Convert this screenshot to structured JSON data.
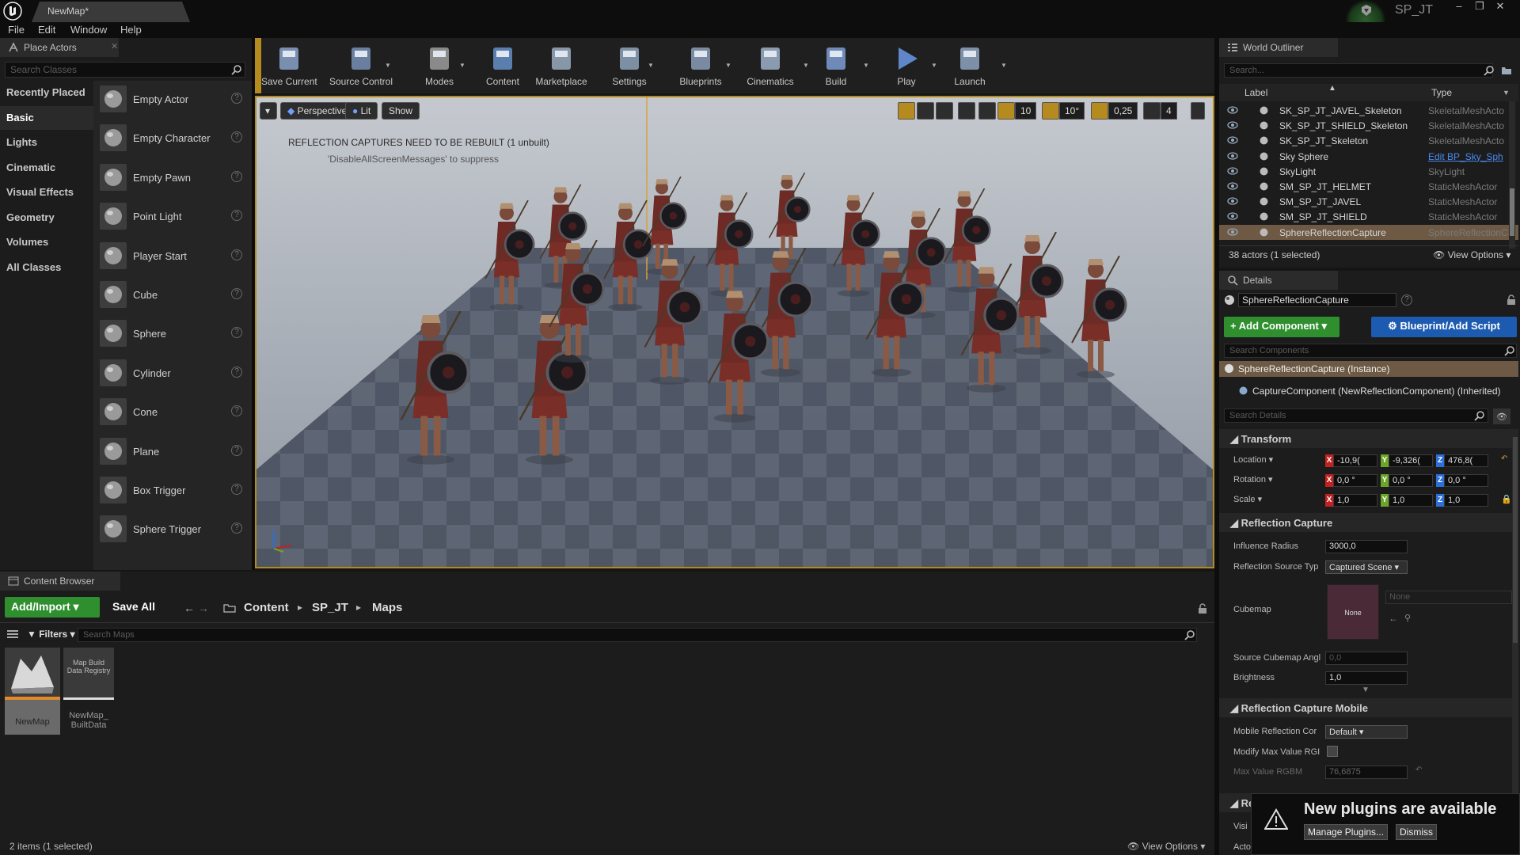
{
  "titlebar": {
    "map_tab": "NewMap*",
    "project": "SP_JT"
  },
  "menu": [
    "File",
    "Edit",
    "Window",
    "Help"
  ],
  "place_actors": {
    "tab_label": "Place Actors",
    "search_placeholder": "Search Classes",
    "categories": [
      "Recently Placed",
      "Basic",
      "Lights",
      "Cinematic",
      "Visual Effects",
      "Geometry",
      "Volumes",
      "All Classes"
    ],
    "active_category": "Basic",
    "actors": [
      "Empty Actor",
      "Empty Character",
      "Empty Pawn",
      "Point Light",
      "Player Start",
      "Cube",
      "Sphere",
      "Cylinder",
      "Cone",
      "Plane",
      "Box Trigger",
      "Sphere Trigger"
    ]
  },
  "toolbar": {
    "buttons": [
      "Save Current",
      "Source Control",
      "Modes",
      "Content",
      "Marketplace",
      "Settings",
      "Blueprints",
      "Cinematics",
      "Build",
      "Play",
      "Launch"
    ]
  },
  "viewport": {
    "perspective": "Perspective",
    "lit": "Lit",
    "show": "Show",
    "grid_snap": "10",
    "rotation_snap": "10°",
    "scale_snap": "0,25",
    "camera_speed": "4",
    "warning": "REFLECTION CAPTURES NEED TO BE REBUILT (1 unbuilt)",
    "warning_hint": "'DisableAllScreenMessages' to suppress"
  },
  "content_browser": {
    "tab_label": "Content Browser",
    "add_import": "Add/Import",
    "save_all": "Save All",
    "path": [
      "Content",
      "SP_JT",
      "Maps"
    ],
    "filters": "Filters",
    "search_placeholder": "Search Maps",
    "assets": [
      {
        "name": "NewMap",
        "thumb_text": ""
      },
      {
        "name": "NewMap_ BuiltData",
        "thumb_text": "Map Build Data Registry"
      }
    ],
    "status": "2 items (1 selected)",
    "view_options": "View Options"
  },
  "outliner": {
    "tab_label": "World Outliner",
    "search_placeholder": "Search...",
    "col_label": "Label",
    "col_type": "Type",
    "rows": [
      {
        "label": "SK_SP_JT_JAVEL_Skeleton",
        "type": "SkeletalMeshActo",
        "icon": "skeleton-icon"
      },
      {
        "label": "SK_SP_JT_SHIELD_Skeleton",
        "type": "SkeletalMeshActo",
        "icon": "skeleton-icon"
      },
      {
        "label": "SK_SP_JT_Skeleton",
        "type": "SkeletalMeshActo",
        "icon": "skeleton-icon"
      },
      {
        "label": "Sky Sphere",
        "type": "Edit BP_Sky_Sph",
        "icon": "sphere-icon"
      },
      {
        "label": "SkyLight",
        "type": "SkyLight",
        "icon": "skylight-icon"
      },
      {
        "label": "SM_SP_JT_HELMET",
        "type": "StaticMeshActor",
        "icon": "mesh-icon"
      },
      {
        "label": "SM_SP_JT_JAVEL",
        "type": "StaticMeshActor",
        "icon": "mesh-icon"
      },
      {
        "label": "SM_SP_JT_SHIELD",
        "type": "StaticMeshActor",
        "icon": "mesh-icon"
      },
      {
        "label": "SphereReflectionCapture",
        "type": "SphereReflectionC",
        "icon": "reflection-icon"
      }
    ],
    "selected_index": 8,
    "status": "38 actors (1 selected)",
    "view_options": "View Options"
  },
  "details": {
    "tab_label": "Details",
    "object_name": "SphereReflectionCapture",
    "add_component": "Add Component",
    "blueprint_script": "Blueprint/Add Script",
    "search_components": "Search Components",
    "instance": "SphereReflectionCapture (Instance)",
    "component": "CaptureComponent (NewReflectionComponent) (Inherited)",
    "search_details": "Search Details",
    "transform": {
      "header": "Transform",
      "location_label": "Location",
      "rotation_label": "Rotation",
      "scale_label": "Scale",
      "location": [
        "-10,9(",
        "-9,326(",
        "476,8("
      ],
      "rotation": [
        "0,0 °",
        "0,0 °",
        "0,0 °"
      ],
      "scale": [
        "1,0",
        "1,0",
        "1,0"
      ]
    },
    "reflection_capture": {
      "header": "Reflection Capture",
      "influence_radius_label": "Influence Radius",
      "influence_radius": "3000,0",
      "source_type_label": "Reflection Source Typ",
      "source_type": "Captured Scene",
      "cubemap_label": "Cubemap",
      "cubemap_value": "None",
      "cubemap_dropdown": "None",
      "angle_label": "Source Cubemap Angl",
      "angle": "0,0",
      "brightness_label": "Brightness",
      "brightness": "1,0"
    },
    "mobile": {
      "header": "Reflection Capture Mobile",
      "mode_label": "Mobile Reflection Cor",
      "mode": "Default",
      "modify_label": "Modify Max Value RGI",
      "max_label": "Max Value RGBM",
      "max_value": "76,6875"
    },
    "rendering_header": "Ren",
    "visible_label": "Visi",
    "hidden_label": "Actor Hidden in Game"
  },
  "toast": {
    "title": "New plugins are available",
    "manage": "Manage Plugins...",
    "dismiss": "Dismiss"
  },
  "colors": {
    "accent_green": "#2f8f2f",
    "accent_blue": "#1d5bb0",
    "selection_gold": "#b58a1e",
    "axis_x": "#c42020",
    "axis_y": "#6da52a",
    "axis_z": "#2b6fd8"
  }
}
